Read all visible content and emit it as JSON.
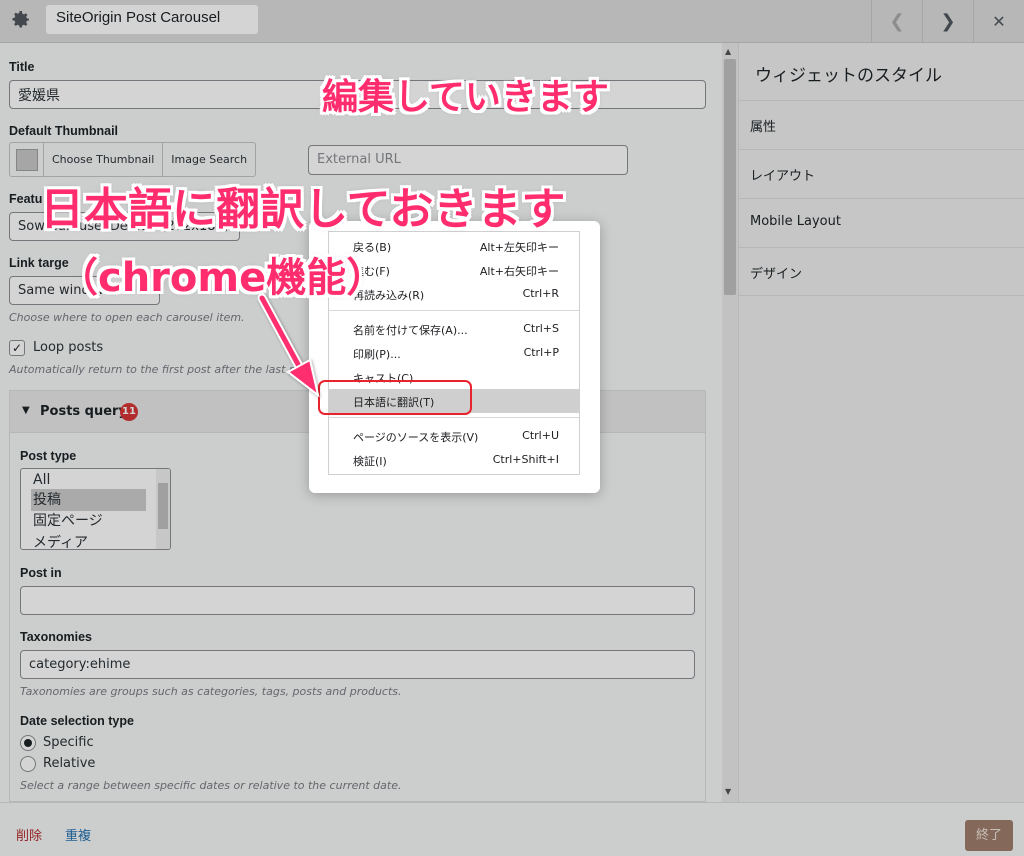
{
  "header": {
    "title": "SiteOrigin Post Carousel",
    "prev_icon": "chevron-left-icon",
    "next_icon": "chevron-right-icon",
    "close_icon": "close-icon"
  },
  "form": {
    "title_label": "Title",
    "title_value": "愛媛県",
    "thumb_label": "Default Thumbnail",
    "choose_thumb": "Choose Thumbnail",
    "image_search": "Image Search",
    "external_url_placeholder": "External URL",
    "featured_label": "Featu",
    "image_size_value": "Sow Carousel Default (272x182)",
    "link_target_label": "Link targe",
    "link_target_value": "Same window",
    "link_target_hint": "Choose where to open each carousel item.",
    "loop_label": "Loop posts",
    "loop_hint": "Automatically return to the first post after the last post.",
    "posts_query_title": "Posts query",
    "posts_query_badge": "11",
    "post_type_label": "Post type",
    "post_type_options": [
      "All",
      "投稿",
      "固定ページ",
      "メディア"
    ],
    "post_type_selected": "投稿",
    "post_in_label": "Post in",
    "taxonomies_label": "Taxonomies",
    "taxonomies_value": "category:ehime",
    "taxonomies_hint": "Taxonomies are groups such as categories, tags, posts and products.",
    "date_type_label": "Date selection type",
    "date_specific": "Specific",
    "date_relative": "Relative",
    "date_hint": "Select a range between specific dates or relative to the current date."
  },
  "sidebar": {
    "title": "ウィジェットのスタイル",
    "items": [
      "属性",
      "レイアウト",
      "Mobile Layout",
      "デザイン"
    ]
  },
  "footer": {
    "delete": "削除",
    "duplicate": "重複",
    "done": "終了"
  },
  "context_menu": {
    "items": [
      {
        "label": "戻る(B)",
        "shortcut": "Alt+左矢印キー"
      },
      {
        "label": "進む(F)",
        "shortcut": "Alt+右矢印キー"
      },
      {
        "label": "再読み込み(R)",
        "shortcut": "Ctrl+R"
      },
      {
        "label": "名前を付けて保存(A)...",
        "shortcut": "Ctrl+S"
      },
      {
        "label": "印刷(P)...",
        "shortcut": "Ctrl+P"
      },
      {
        "label": "キャスト(C)...",
        "shortcut": ""
      },
      {
        "label": "日本語に翻訳(T)",
        "shortcut": ""
      },
      {
        "label": "ページのソースを表示(V)",
        "shortcut": "Ctrl+U"
      },
      {
        "label": "検証(I)",
        "shortcut": "Ctrl+Shift+I"
      }
    ]
  },
  "annotations": {
    "line1": "編集していきます",
    "line2": "日本語に翻訳しておきます",
    "line3": "（chrome機能）"
  },
  "colors": {
    "annotation": "#ff2d6e",
    "highlight_border": "#e8232e",
    "done_button": "#9f7d6c"
  }
}
